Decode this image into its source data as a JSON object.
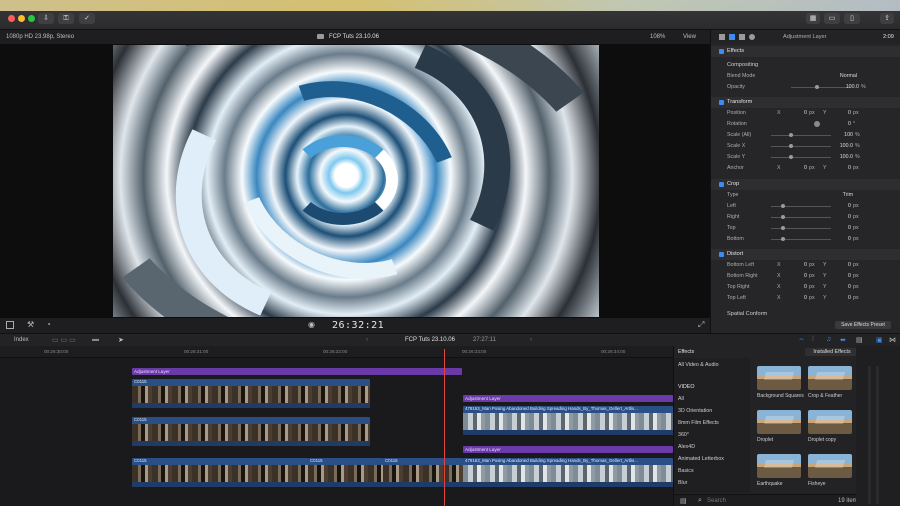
{
  "window": {
    "title": "FCP Tuts 23.10.06"
  },
  "viewer": {
    "format": "1080p HD 23.98p, Stereo",
    "zoom": "108%",
    "view_label": "View",
    "timecode": "26:32:21"
  },
  "inspector": {
    "title": "Adjustment Layer",
    "duration": "2:09",
    "save_preset": "Save Effects Preset",
    "sections": [
      {
        "name": "Effects"
      },
      {
        "name": "Compositing",
        "rows": [
          {
            "label": "Blend Mode",
            "value": "Normal"
          },
          {
            "label": "Opacity",
            "value": "100.0",
            "unit": "%"
          }
        ]
      },
      {
        "name": "Transform",
        "rows": [
          {
            "label": "Position",
            "x": "0",
            "y": "0",
            "unit": "px"
          },
          {
            "label": "Rotation",
            "value": "0",
            "unit": "°"
          },
          {
            "label": "Scale (All)",
            "value": "100",
            "unit": "%"
          },
          {
            "label": "Scale X",
            "value": "100.0",
            "unit": "%"
          },
          {
            "label": "Scale Y",
            "value": "100.0",
            "unit": "%"
          },
          {
            "label": "Anchor",
            "x": "0",
            "y": "0",
            "unit": "px"
          }
        ]
      },
      {
        "name": "Crop",
        "rows": [
          {
            "label": "Type",
            "value": "Trim"
          },
          {
            "label": "Left",
            "value": "0",
            "unit": "px"
          },
          {
            "label": "Right",
            "value": "0",
            "unit": "px"
          },
          {
            "label": "Top",
            "value": "0",
            "unit": "px"
          },
          {
            "label": "Bottom",
            "value": "0",
            "unit": "px"
          }
        ]
      },
      {
        "name": "Distort",
        "rows": [
          {
            "label": "Bottom Left",
            "x": "0",
            "y": "0",
            "unit": "px"
          },
          {
            "label": "Bottom Right",
            "x": "0",
            "y": "0",
            "unit": "px"
          },
          {
            "label": "Top Right",
            "x": "0",
            "y": "0",
            "unit": "px"
          },
          {
            "label": "Top Left",
            "x": "0",
            "y": "0",
            "unit": "px"
          }
        ]
      },
      {
        "name": "Spatial Conform"
      }
    ]
  },
  "timeline": {
    "index_label": "Index",
    "project": "FCP Tuts 23.10.06",
    "duration": "27:27:11",
    "ruler": [
      "00:26:30:00",
      "00:26:31:00",
      "00:26:32:00",
      "00:26:33:00",
      "00:26:34:00"
    ],
    "adjustment_label": "Adjustment Layer",
    "clip_c0115": "C0115",
    "clip_long": "479163_Man Posing Abandoned Building Spreading Hands_By_Thomas_Gellert_Artlis..."
  },
  "effects": {
    "title": "Effects",
    "installed": "Installed Effects",
    "categories": [
      "All Video & Audio",
      "VIDEO",
      "All",
      "3D Orientation",
      "8mm Film Effects",
      "360°",
      "Alex4D",
      "Animated Letterbox",
      "Basics",
      "Blur"
    ],
    "items": [
      "Background Squares",
      "Crop & Feather",
      "Droplet",
      "Droplet copy",
      "Earthquake",
      "Fisheye"
    ],
    "count": "19 items",
    "search_placeholder": "Search"
  },
  "colors": {
    "accent": "#3d8cf0",
    "adjustment": "#6a3aa8",
    "clip": "#2a4f86",
    "playhead": "#e0443d"
  }
}
